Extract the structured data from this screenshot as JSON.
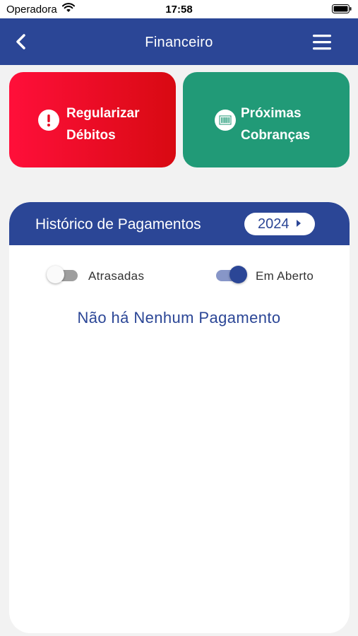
{
  "status": {
    "carrier": "Operadora",
    "time": "17:58"
  },
  "nav": {
    "title": "Financeiro",
    "back_icon": "chevron-left-icon",
    "menu_icon": "hamburger-menu-icon"
  },
  "cards": [
    {
      "line1": "Regularizar",
      "line2": "Débitos",
      "icon": "exclamation-icon",
      "color": "#e60a23"
    },
    {
      "line1": "Próximas",
      "line2": "Cobranças",
      "icon": "barcode-icon",
      "color": "#219a77"
    }
  ],
  "history": {
    "title": "Histórico de Pagamentos",
    "year": "2024",
    "filters": [
      {
        "label": "Atrasadas",
        "on": false
      },
      {
        "label": "Em Aberto",
        "on": true
      }
    ],
    "empty_message": "Não há Nenhum Pagamento"
  },
  "colors": {
    "primary": "#2b4696",
    "danger": "#e60a23",
    "success": "#219a77",
    "background": "#f2f2f2"
  }
}
